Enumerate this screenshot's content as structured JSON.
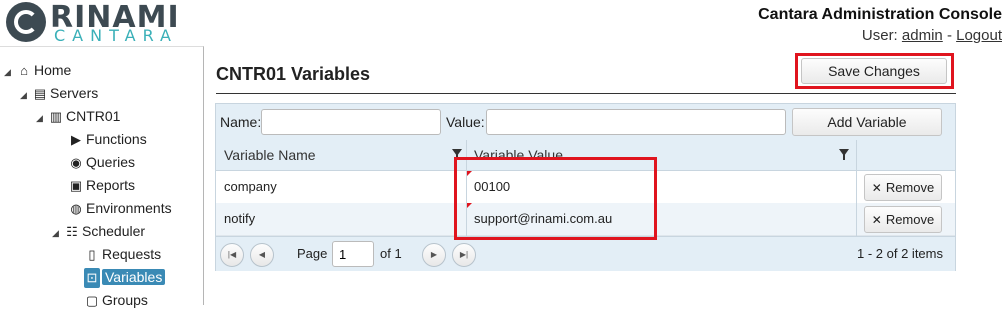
{
  "header": {
    "logo_top": "RINAMI",
    "logo_bottom": "CANTARA",
    "app_title": "Cantara Administration Console",
    "user_prefix": "User:",
    "user_name": "admin",
    "separator": "-",
    "logout": "Logout"
  },
  "sidebar": {
    "items": [
      {
        "label": "Home",
        "icon": "home-icon"
      },
      {
        "label": "Servers",
        "icon": "servers-icon"
      },
      {
        "label": "CNTR01",
        "icon": "server-icon"
      },
      {
        "label": "Functions",
        "icon": "function-icon"
      },
      {
        "label": "Queries",
        "icon": "database-icon"
      },
      {
        "label": "Reports",
        "icon": "printer-icon"
      },
      {
        "label": "Environments",
        "icon": "globe-icon"
      },
      {
        "label": "Scheduler",
        "icon": "scheduler-icon"
      },
      {
        "label": "Requests",
        "icon": "document-icon"
      },
      {
        "label": "Variables",
        "icon": "variables-icon"
      },
      {
        "label": "Groups",
        "icon": "groups-icon"
      }
    ]
  },
  "main": {
    "title": "CNTR01 Variables",
    "save_label": "Save Changes",
    "toolbar": {
      "name_label": "Name:",
      "name_value": "",
      "value_label": "Value:",
      "value_value": "",
      "add_label": "Add Variable"
    },
    "columns": [
      "Variable Name",
      "Variable Value"
    ],
    "rows": [
      {
        "name": "company",
        "value": "00100",
        "remove": "Remove"
      },
      {
        "name": "notify",
        "value": "support@rinami.com.au",
        "remove": "Remove"
      }
    ],
    "pager": {
      "page_label": "Page",
      "page_value": "1",
      "of_label": "of 1",
      "info": "1 - 2 of 2 items"
    }
  },
  "colors": {
    "accent": "#3a8ab5",
    "highlight_box": "#e0141e",
    "grid_header": "#e3eef6"
  }
}
